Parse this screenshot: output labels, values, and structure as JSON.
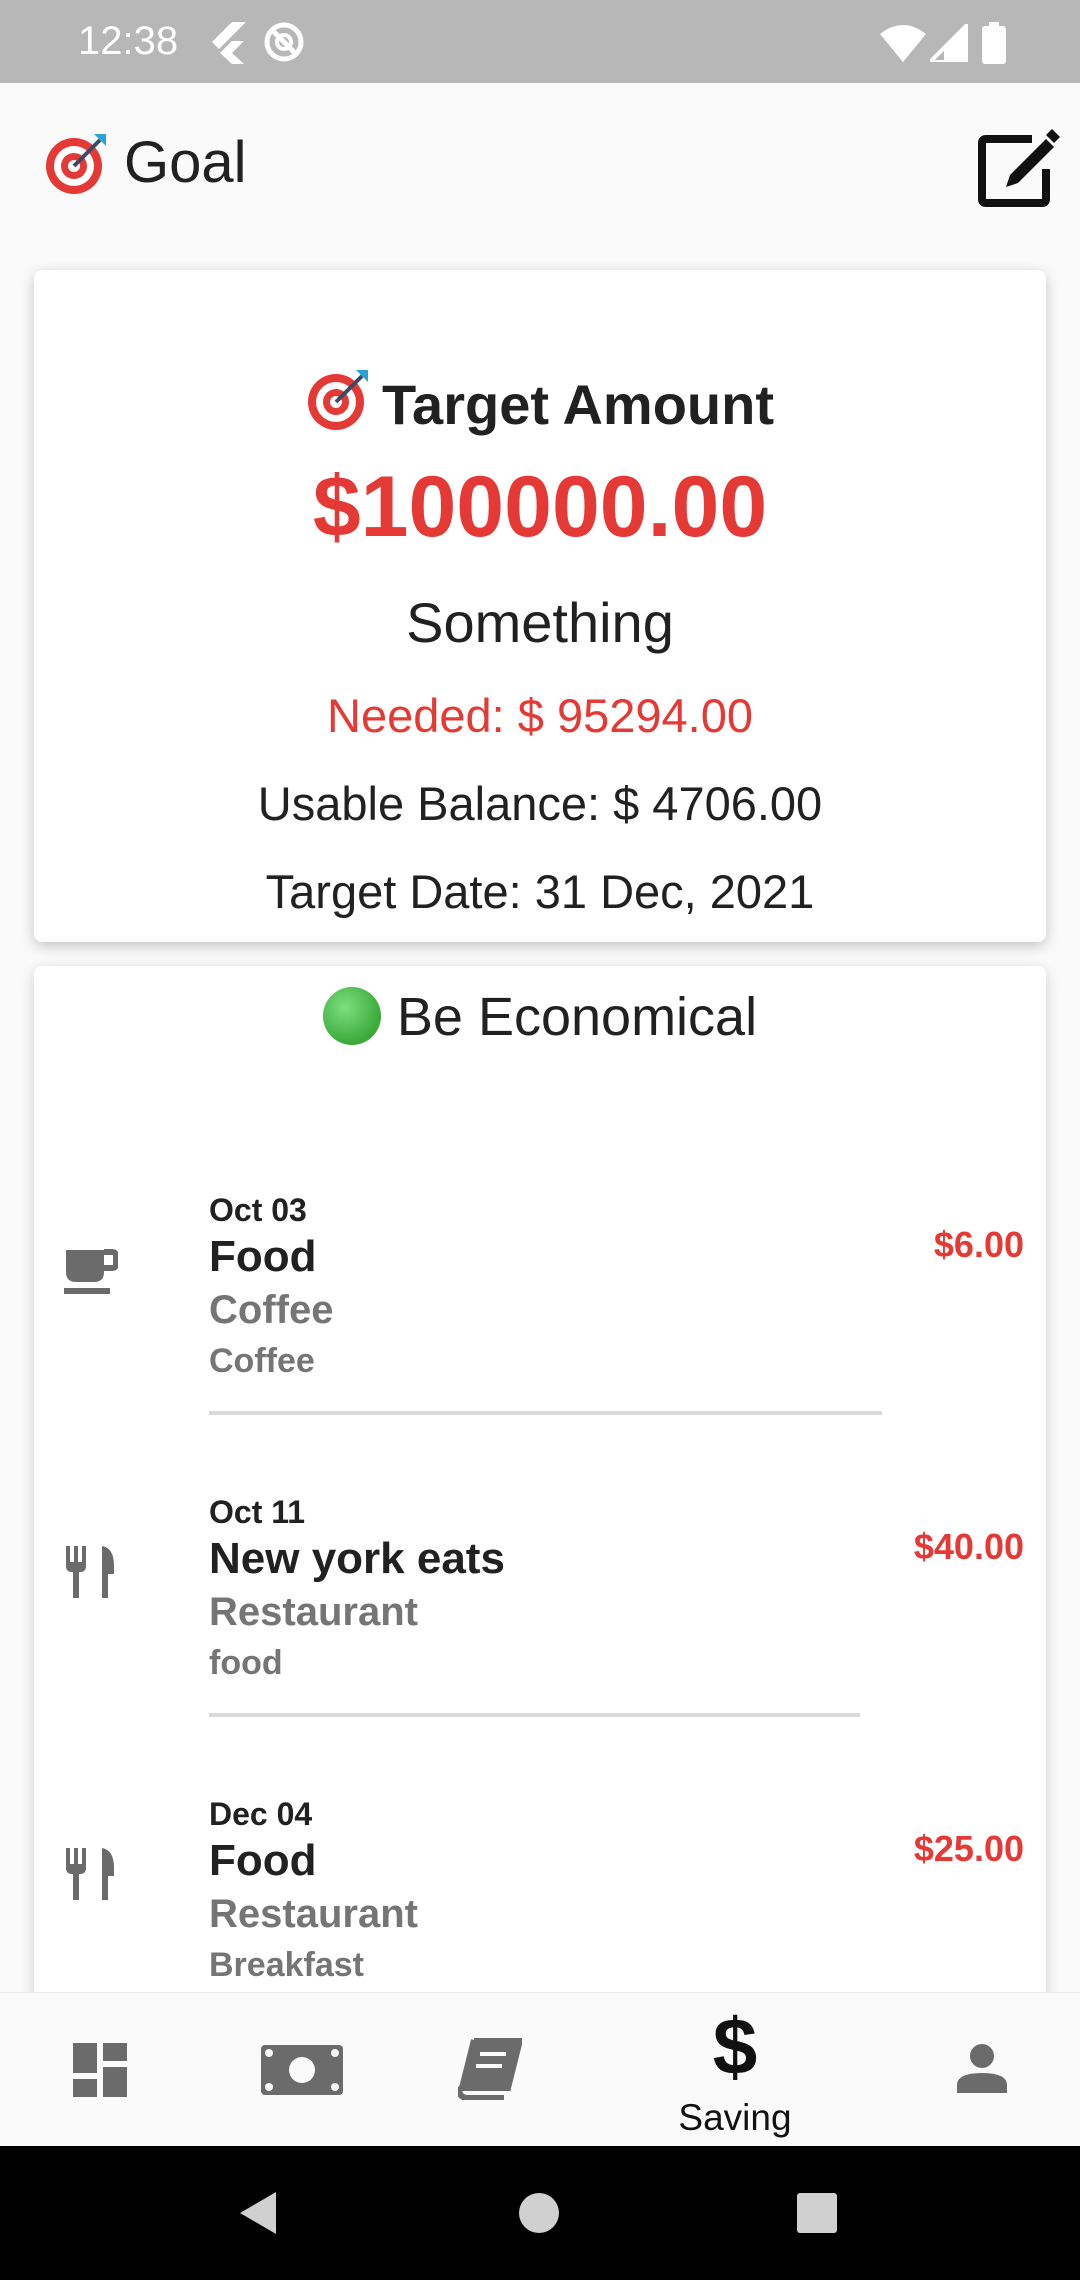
{
  "status_bar": {
    "time": "12:38"
  },
  "app_bar": {
    "title": "Goal",
    "title_icon": "target-dart-emoji",
    "edit_icon": "edit-icon"
  },
  "target": {
    "title": "Target Amount",
    "amount": "$100000.00",
    "name": "Something",
    "needed": "Needed: $ 95294.00",
    "balance": "Usable Balance: $ 4706.00",
    "date": "Target Date: 31 Dec, 2021"
  },
  "section": {
    "title": "Be Economical",
    "status_color": "#3aa93a"
  },
  "transactions": [
    {
      "date": "Oct 03",
      "title": "Food",
      "category": "Coffee",
      "note": "Coffee",
      "amount": "$6.00",
      "icon": "coffee-cup-icon"
    },
    {
      "date": "Oct 11",
      "title": "New york eats",
      "category": "Restaurant",
      "note": "food",
      "amount": "$40.00",
      "icon": "fork-knife-icon"
    },
    {
      "date": "Dec 04",
      "title": "Food",
      "category": "Restaurant",
      "note": "Breakfast",
      "amount": "$25.00",
      "icon": "fork-knife-icon"
    }
  ],
  "bottom_nav": {
    "items": [
      {
        "icon": "dashboard-icon",
        "label": ""
      },
      {
        "icon": "cash-icon",
        "label": ""
      },
      {
        "icon": "book-icon",
        "label": ""
      },
      {
        "icon": "dollar-icon",
        "label": "Saving",
        "symbol": "$",
        "active": true
      },
      {
        "icon": "person-icon",
        "label": ""
      }
    ]
  },
  "colors": {
    "accent_red": "#e53935",
    "text": "#212121",
    "muted": "#757575"
  }
}
